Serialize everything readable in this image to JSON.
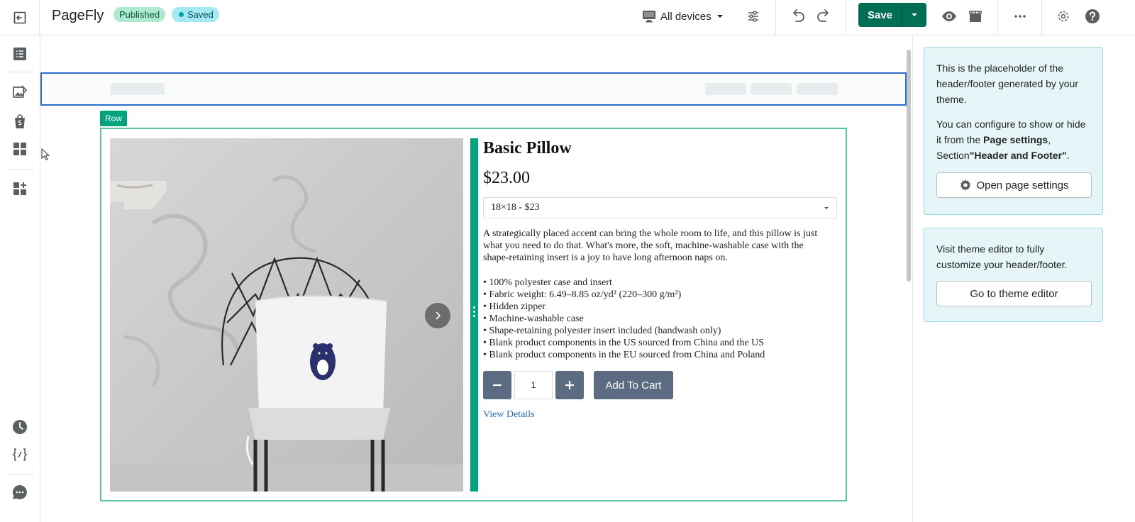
{
  "topbar": {
    "brand": "PageFly",
    "status_published": "Published",
    "status_saved": "Saved",
    "device_label": "All devices",
    "save_label": "Save"
  },
  "canvas": {
    "row_label": "Row"
  },
  "product": {
    "title": "Basic Pillow",
    "price": "$23.00",
    "variant": "18×18 - $23",
    "description": "A strategically placed accent can bring the whole room to life, and this pillow is just what you need to do that. What's more, the soft, machine-washable case with the shape-retaining insert is a joy to have long afternoon naps on.",
    "bullets": [
      "• 100% polyester case and insert",
      "• Fabric weight: 6.49–8.85 oz/yd² (220–300 g/m²)",
      "• Hidden zipper",
      "• Machine-washable case",
      "• Shape-retaining polyester insert included (handwash only)",
      "• Blank product components in the US sourced from China and the US",
      "• Blank product components in the EU sourced from China and Poland"
    ],
    "quantity": "1",
    "add_to_cart": "Add To Cart",
    "view_details": "View Details"
  },
  "right_panel": {
    "card1_text1": "This is the placeholder of the header/footer generated by your theme.",
    "card1_text2_pre": "You can configure to show or hide it from the ",
    "card1_text2_bold1": "Page settings",
    "card1_text2_mid": ", Section",
    "card1_text2_bold2": "\"Header and Footer\"",
    "card1_text2_post": ".",
    "open_settings_label": "Open page settings",
    "card2_text": "Visit theme editor to fully customize your header/footer.",
    "theme_editor_label": "Go to theme editor"
  },
  "colors": {
    "save_green": "#006e52",
    "row_accent": "#00a47c",
    "selection_blue": "#2c6ecb",
    "cart_button": "#5b6b82"
  }
}
